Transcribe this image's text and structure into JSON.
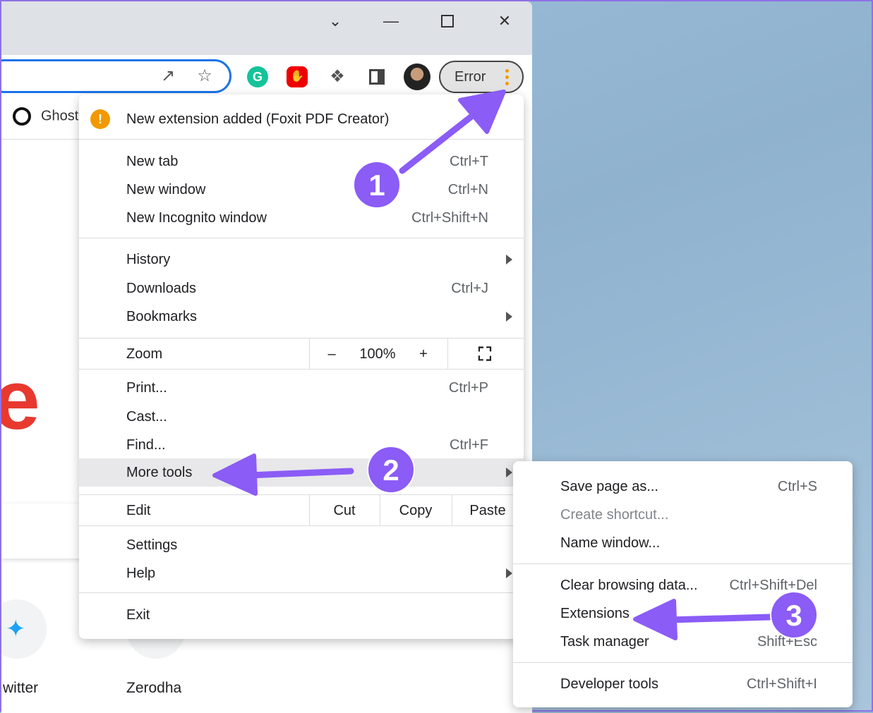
{
  "window": {
    "controls": [
      "tab-search",
      "minimize",
      "maximize",
      "close"
    ]
  },
  "toolbar": {
    "error_label": "Error",
    "extensions": [
      "grammarly",
      "adblock",
      "extensions-puzzle",
      "side-panel",
      "profile-avatar"
    ]
  },
  "bookmarks": {
    "first": "Ghost"
  },
  "page": {
    "logo_letter": "e",
    "tiles": [
      {
        "label": "witter"
      },
      {
        "label": "Zerodha"
      }
    ]
  },
  "menu": {
    "notification": "New extension added (Foxit PDF Creator)",
    "group1": [
      {
        "label": "New tab",
        "shortcut": "Ctrl+T"
      },
      {
        "label": "New window",
        "shortcut": "Ctrl+N"
      },
      {
        "label": "New Incognito window",
        "shortcut": "Ctrl+Shift+N"
      }
    ],
    "group2": [
      {
        "label": "History",
        "shortcut": ""
      },
      {
        "label": "Downloads",
        "shortcut": "Ctrl+J"
      },
      {
        "label": "Bookmarks",
        "shortcut": ""
      }
    ],
    "zoom": {
      "label": "Zoom",
      "minus": "–",
      "value": "100%",
      "plus": "+"
    },
    "group3": [
      {
        "label": "Print...",
        "shortcut": "Ctrl+P"
      },
      {
        "label": "Cast...",
        "shortcut": ""
      },
      {
        "label": "Find...",
        "shortcut": "Ctrl+F"
      },
      {
        "label": "More tools",
        "shortcut": ""
      }
    ],
    "edit": {
      "label": "Edit",
      "cut": "Cut",
      "copy": "Copy",
      "paste": "Paste"
    },
    "group4": [
      {
        "label": "Settings"
      },
      {
        "label": "Help"
      }
    ],
    "exit": "Exit"
  },
  "submenu": {
    "group1": [
      {
        "label": "Save page as...",
        "shortcut": "Ctrl+S"
      },
      {
        "label": "Create shortcut...",
        "shortcut": ""
      },
      {
        "label": "Name window...",
        "shortcut": ""
      }
    ],
    "group2": [
      {
        "label": "Clear browsing data...",
        "shortcut": "Ctrl+Shift+Del"
      },
      {
        "label": "Extensions",
        "shortcut": ""
      },
      {
        "label": "Task manager",
        "shortcut": "Shift+Esc"
      }
    ],
    "group3": [
      {
        "label": "Developer tools",
        "shortcut": "Ctrl+Shift+I"
      }
    ]
  },
  "annotations": {
    "color": "#8b5cf6",
    "steps": [
      "1",
      "2",
      "3"
    ]
  }
}
